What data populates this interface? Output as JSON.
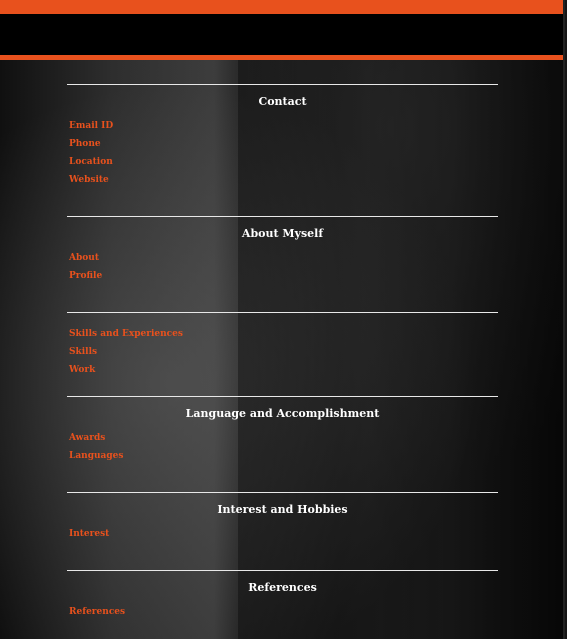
{
  "colors": {
    "accent": "#e8511d",
    "header_background": "#000000",
    "section_title": "#ffffff",
    "divider": "#e8e8e8"
  },
  "sections": [
    {
      "title": "Contact",
      "items": [
        "Email ID",
        "Phone",
        "Location",
        "Website"
      ]
    },
    {
      "title": "About Myself",
      "items": [
        "About",
        "Profile"
      ]
    },
    {
      "title": "",
      "items": [
        "Skills and Experiences",
        "Skills",
        "Work"
      ]
    },
    {
      "title": "Language and Accomplishment",
      "items": [
        "Awards",
        "Languages"
      ]
    },
    {
      "title": "Interest and Hobbies",
      "items": [
        "Interest"
      ]
    },
    {
      "title": "References",
      "items": [
        "References"
      ]
    }
  ]
}
